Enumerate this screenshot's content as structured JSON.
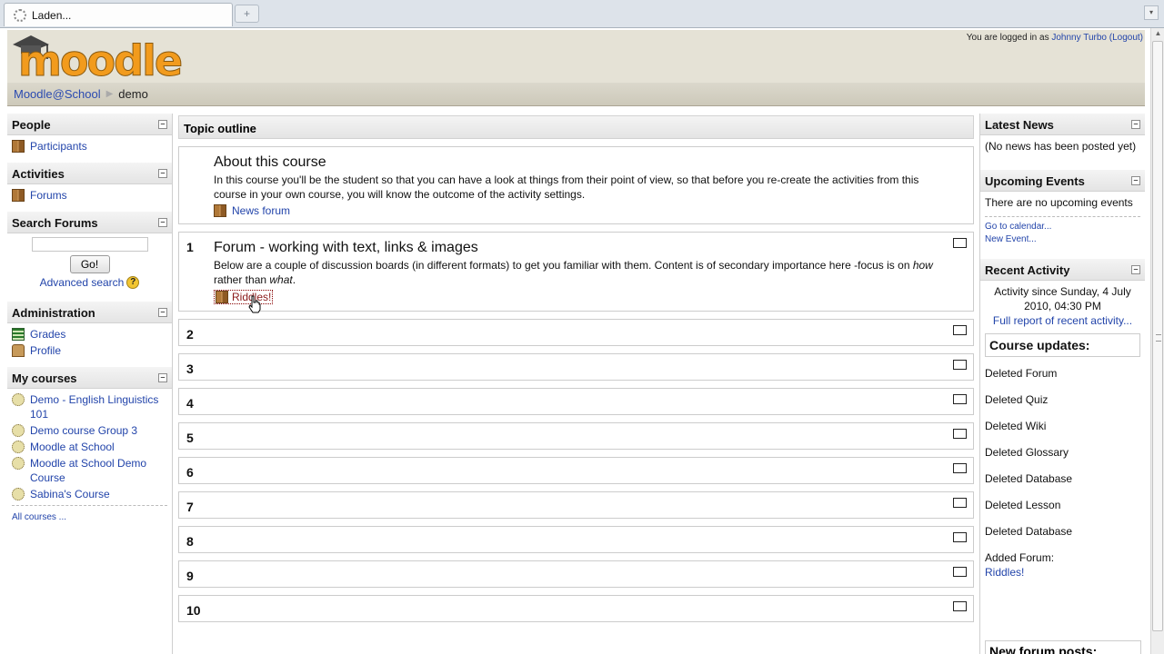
{
  "browser": {
    "tab_title": "Laden...",
    "new_tab_label": "+"
  },
  "header": {
    "logo_text": "moodle",
    "login_prefix": "You are logged in as",
    "user_name": "Johnny Turbo",
    "logout_label": "(Logout)"
  },
  "navbar": {
    "home": "Moodle@School",
    "separator": "▶",
    "current": "demo"
  },
  "left": {
    "people": {
      "title": "People",
      "items": [
        {
          "label": "Participants",
          "icon": "participants-icon"
        }
      ]
    },
    "activities": {
      "title": "Activities",
      "items": [
        {
          "label": "Forums",
          "icon": "forum-icon"
        }
      ]
    },
    "search": {
      "title": "Search Forums",
      "go_label": "Go!",
      "advanced_label": "Advanced search",
      "help_label": "?"
    },
    "administration": {
      "title": "Administration",
      "items": [
        {
          "label": "Grades",
          "icon": "grades-icon"
        },
        {
          "label": "Profile",
          "icon": "profile-icon"
        }
      ]
    },
    "courses": {
      "title": "My courses",
      "items": [
        "Demo - English Linguistics 101",
        "Demo course Group 3",
        "Moodle at School",
        "Moodle at School Demo Course",
        "Sabina's Course"
      ],
      "all_label": "All courses ..."
    }
  },
  "center": {
    "title": "Topic outline",
    "about": {
      "title": "About this course",
      "summary": "In this course you'll be the student so that you can have a look at things from their point of view, so that before you re-create the activities from this course in your own course, you will know the outcome of the activity settings.",
      "activity": "News forum"
    },
    "topic1": {
      "number": "1",
      "title": "Forum - working with text, links & images",
      "summary_a": "Below are a couple of discussion boards (in different formats) to get you familiar with them. Content is of secondary importance here -focus is on ",
      "summary_how": "how",
      "summary_b": " rather than ",
      "summary_what": "what",
      "summary_c": ".",
      "activity": "Riddles!"
    },
    "empty_sections": [
      "2",
      "3",
      "4",
      "5",
      "6",
      "7",
      "8",
      "9",
      "10"
    ]
  },
  "right": {
    "news": {
      "title": "Latest News",
      "text": "(No news has been posted yet)"
    },
    "events": {
      "title": "Upcoming Events",
      "text": "There are no upcoming events",
      "calendar_link": "Go to calendar...",
      "new_event_link": "New Event..."
    },
    "recent": {
      "title": "Recent Activity",
      "since": "Activity since Sunday, 4 July 2010, 04:30 PM",
      "full_report": "Full report of recent activity...",
      "updates_title": "Course updates:",
      "updates": [
        "Deleted Forum",
        "Deleted Quiz",
        "Deleted Wiki",
        "Deleted Glossary",
        "Deleted Database",
        "Deleted Lesson",
        "Deleted Database"
      ],
      "added_label": "Added Forum:",
      "added_item": "Riddles!",
      "new_posts_title": "New forum posts:"
    }
  },
  "colors": {
    "link": "#2244aa",
    "header_bg": "#e5e2d6",
    "logo_orange": "#f29b1d"
  }
}
